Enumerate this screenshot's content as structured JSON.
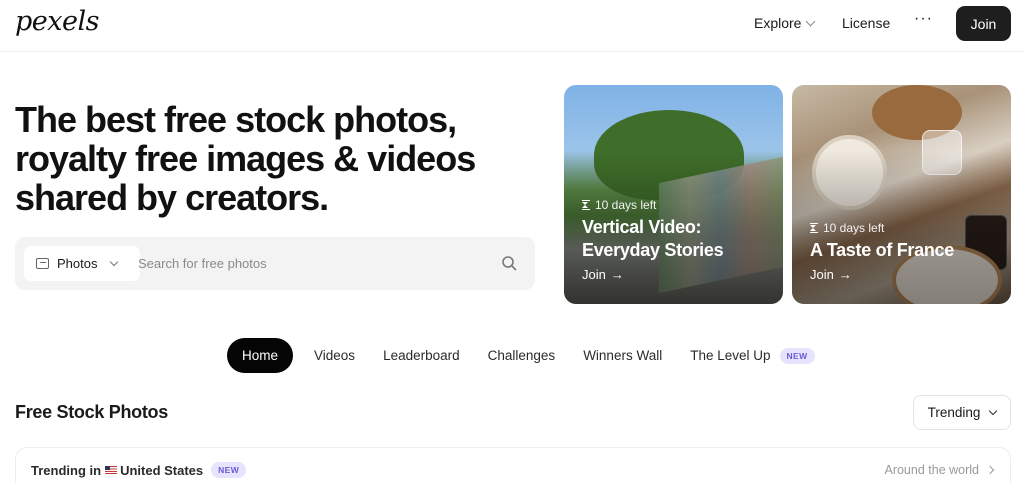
{
  "header": {
    "logo": "pexels",
    "nav": {
      "explore": "Explore",
      "license": "License",
      "more": "···"
    },
    "join": "Join"
  },
  "hero": {
    "title": "The best free stock photos, royalty free images & videos shared by creators.",
    "search": {
      "type_label": "Photos",
      "placeholder": "Search for free photos"
    }
  },
  "challenges": [
    {
      "days_left": "10 days left",
      "title": "Vertical Video: Everyday Stories",
      "join": "Join"
    },
    {
      "days_left": "10 days left",
      "title": "A Taste of France",
      "join": "Join"
    }
  ],
  "tabs": [
    {
      "label": "Home",
      "active": true
    },
    {
      "label": "Videos"
    },
    {
      "label": "Leaderboard"
    },
    {
      "label": "Challenges"
    },
    {
      "label": "Winners Wall"
    },
    {
      "label": "The Level Up",
      "badge": "NEW"
    }
  ],
  "section": {
    "title": "Free Stock Photos",
    "sort": "Trending"
  },
  "trending_bar": {
    "label_prefix": "Trending in",
    "country": "United States",
    "badge": "NEW",
    "around": "Around the world"
  },
  "colors": {
    "join_bg": "#1e1e1e",
    "active_tab_bg": "#050505",
    "badge_bg": "#e6e3ff",
    "badge_text": "#6a5bd1",
    "search_bg": "#f3f3f3"
  }
}
